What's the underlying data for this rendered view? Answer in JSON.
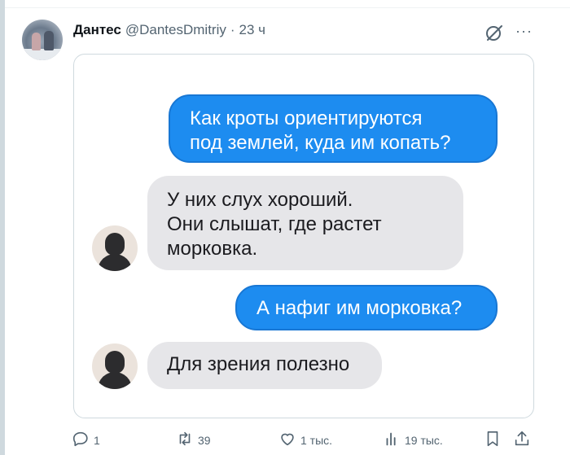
{
  "tweet": {
    "author": {
      "display_name": "Дантес",
      "handle": "@DantesDmitriy",
      "separator": "·",
      "time": "23 ч"
    },
    "icons": {
      "grok": "grok-icon",
      "more": "more-icon"
    },
    "more_glyph": "···",
    "messages": [
      {
        "direction": "outgoing",
        "lines": [
          "Как кроты ориентируются",
          "под землей, куда им копать?"
        ]
      },
      {
        "direction": "incoming",
        "lines": [
          "У них слух хороший.",
          "Они слышат, где растет",
          "морковка."
        ]
      },
      {
        "direction": "outgoing",
        "lines": [
          "А нафиг им морковка?"
        ]
      },
      {
        "direction": "incoming",
        "lines": [
          "Для зрения полезно"
        ]
      }
    ],
    "actions": {
      "reply_count": "1",
      "repost_count": "39",
      "like_count": "1 тыс.",
      "views_count": "19 тыс."
    }
  },
  "colors": {
    "outgoing_bubble": "#1d8cf0",
    "incoming_bubble": "#e6e6e9",
    "secondary_text": "#536471"
  }
}
